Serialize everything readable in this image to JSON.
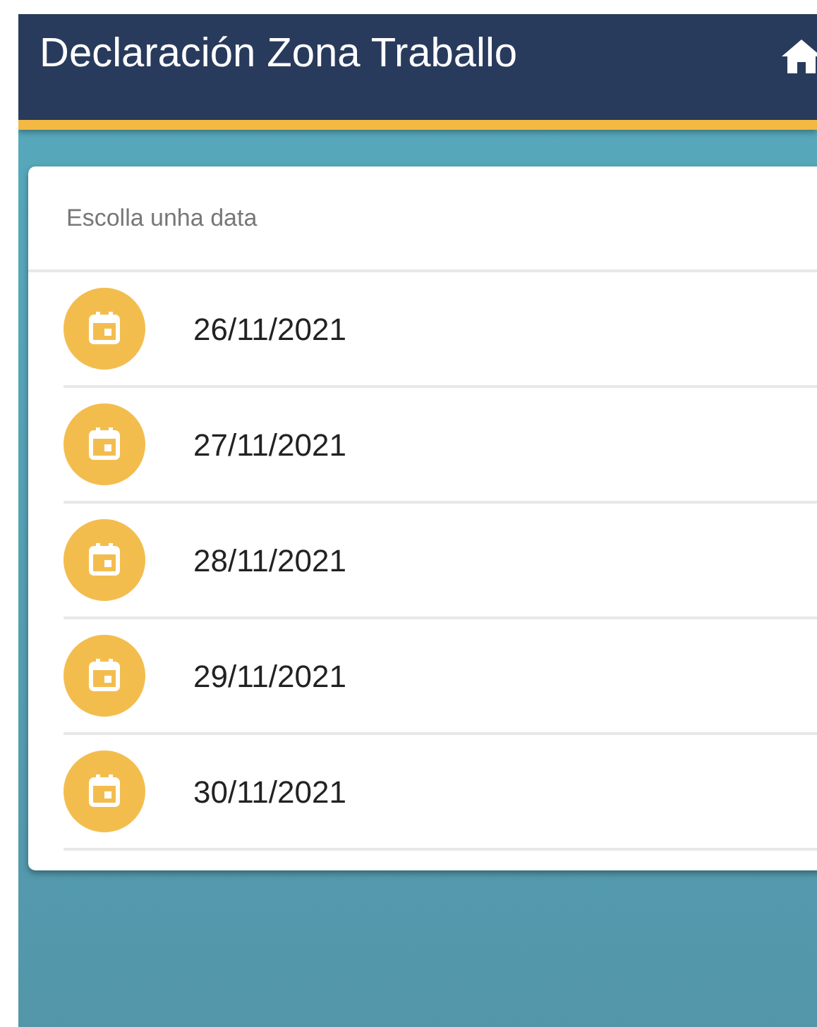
{
  "header": {
    "title": "Declaración Zona Traballo"
  },
  "date_list": {
    "heading": "Escolla unha data",
    "items": [
      {
        "label": "26/11/2021"
      },
      {
        "label": "27/11/2021"
      },
      {
        "label": "28/11/2021"
      },
      {
        "label": "29/11/2021"
      },
      {
        "label": "30/11/2021"
      }
    ]
  }
}
